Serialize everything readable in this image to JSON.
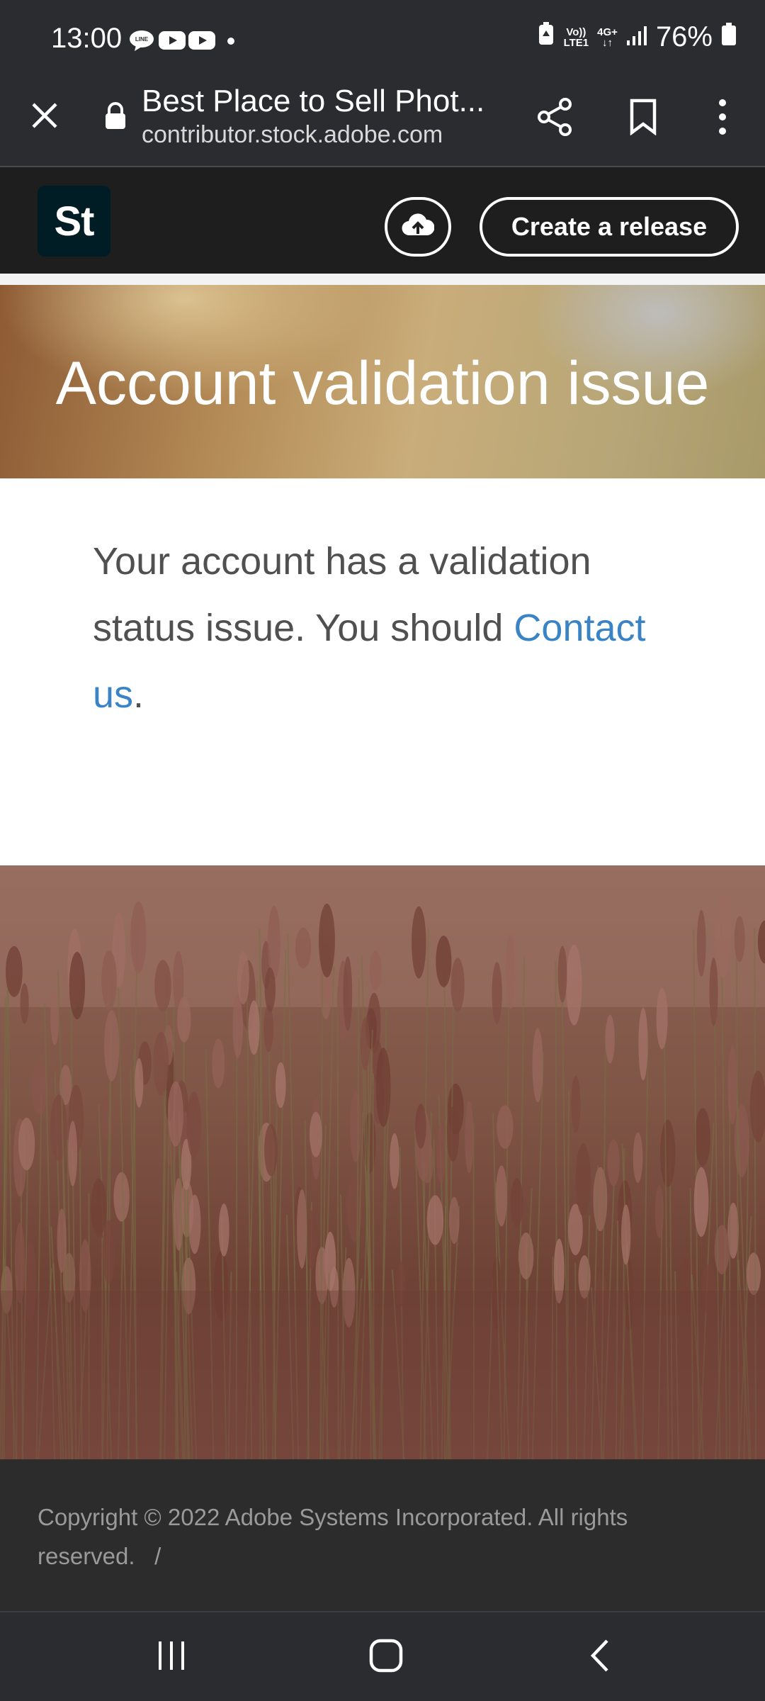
{
  "status_bar": {
    "time": "13:00",
    "volte_line1": "Vo))",
    "volte_line2": "LTE1",
    "network_label": "4G+",
    "battery": "76%",
    "icons": [
      "line-icon",
      "youtube-icon",
      "youtube-icon",
      "dot-icon",
      "battery-saver-icon",
      "signal-icon",
      "battery-icon"
    ]
  },
  "browser": {
    "title": "Best Place to Sell Phot...",
    "url": "contributor.stock.adobe.com",
    "icons": [
      "close-icon",
      "lock-icon",
      "share-icon",
      "bookmark-icon",
      "more-vert-icon"
    ]
  },
  "header": {
    "logo_text": "St",
    "create_release_label": "Create a release",
    "icons": [
      "upload-cloud-icon"
    ]
  },
  "hero": {
    "title": "Account validation issue"
  },
  "message": {
    "text": "Your account has a validation status issue. You should ",
    "link_text": "Contact us",
    "trailing": "."
  },
  "footer": {
    "copyright": "Copyright © 2022 Adobe Systems Incorporated. All rights reserved.",
    "separator": "/"
  },
  "nav": {
    "icons": [
      "recent-apps-icon",
      "home-icon",
      "back-icon"
    ]
  },
  "colors": {
    "link": "#3a83c4",
    "header_bg": "#1e1e1e",
    "footer_bg": "#2c2c2c",
    "logo_bg": "#001d26"
  }
}
